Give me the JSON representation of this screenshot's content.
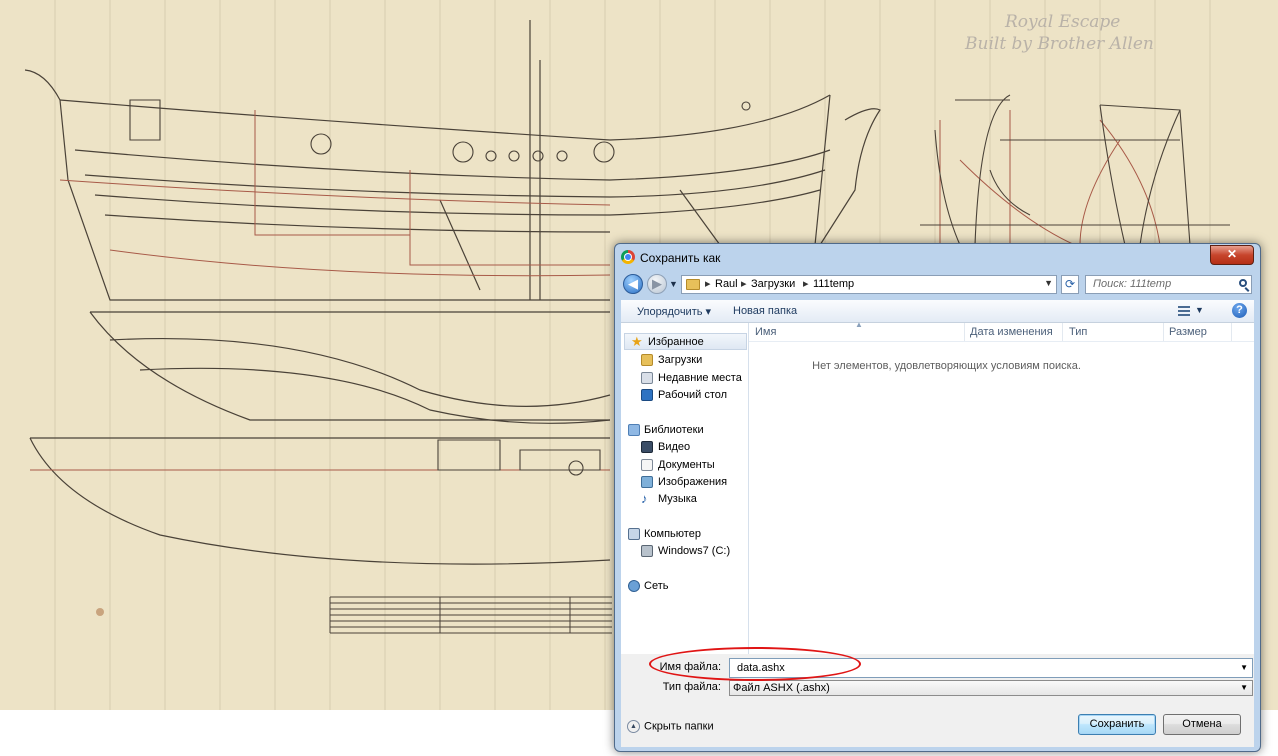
{
  "background": {
    "handwriting_line1": "Royal Escape",
    "handwriting_line2": "Built by Brother Allen",
    "colors": {
      "paper": "#ede3c6",
      "ink": "#4a4238",
      "red_ink": "#a85a48"
    }
  },
  "dialog": {
    "title": "Сохранить как",
    "close_label": "✕",
    "address": {
      "breadcrumbs": [
        "Raul",
        "Загрузки",
        "111temp"
      ],
      "search_placeholder": "Поиск: 111temp"
    },
    "toolbar": {
      "organize_label": "Упорядочить ▾",
      "new_folder_label": "Новая папка",
      "help_label": "?"
    },
    "nav": {
      "favorites": "Избранное",
      "downloads": "Загрузки",
      "recent": "Недавние места",
      "desktop": "Рабочий стол",
      "libraries": "Библиотеки",
      "video": "Видео",
      "documents": "Документы",
      "images": "Изображения",
      "music": "Музыка",
      "computer": "Компьютер",
      "drive": "Windows7 (C:)",
      "network": "Сеть"
    },
    "columns": [
      "Имя",
      "Дата изменения",
      "Тип",
      "Размер"
    ],
    "empty_message": "Нет элементов, удовлетворяющих условиям поиска.",
    "filename_label": "Имя файла:",
    "filename_value": "data.ashx",
    "filetype_label": "Тип файла:",
    "filetype_value": "Файл ASHX (.ashx)",
    "hide_folders_label": "Скрыть папки",
    "save_label": "Сохранить",
    "cancel_label": "Отмена",
    "colors": {
      "frame": "#bcd3ec",
      "highlight_circle": "#e01515"
    }
  }
}
